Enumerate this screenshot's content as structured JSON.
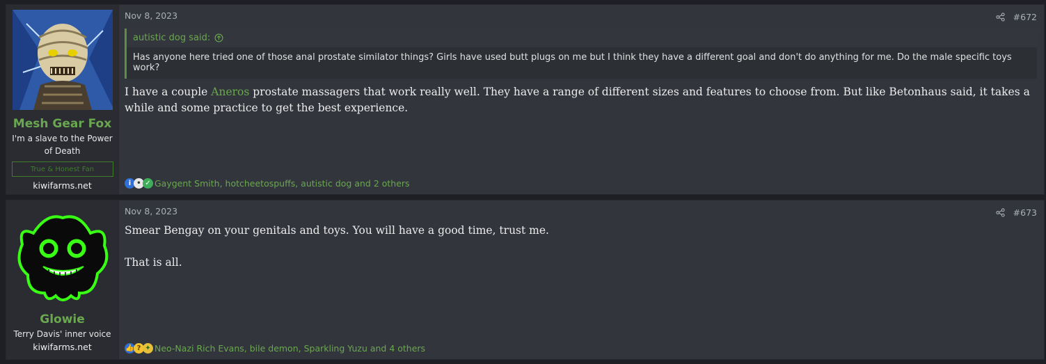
{
  "posts": [
    {
      "user": {
        "name": "Mesh Gear Fox",
        "title": "I'm a slave to the Power of Death",
        "banner": "True & Honest Fan",
        "site": "kiwifarms.net"
      },
      "date": "Nov 8, 2023",
      "number": "#672",
      "quote": {
        "author": "autistic dog said:",
        "text": "Has anyone here tried one of those anal prostate similator things? Girls have used butt plugs on me but I think they have a different goal and don't do anything for me. Do the male specific toys work?"
      },
      "body": {
        "pre": "I have a couple ",
        "link": "Aneros",
        "post": " prostate massagers that work really well. They have a range of different sizes and features to choose from. But like Betonhaus said, it takes a while and some practice to get the best experience."
      },
      "reactions": {
        "icons": [
          "informative-icon",
          "dog-icon",
          "check-icon"
        ],
        "text": "Gaygent Smith, hotcheetospuffs, autistic dog and 2 others"
      }
    },
    {
      "user": {
        "name": "Glowie",
        "title": "Terry Davis' inner voice",
        "site": "kiwifarms.net"
      },
      "date": "Nov 8, 2023",
      "number": "#673",
      "body": {
        "p1": "Smear Bengay on your genitals and toys. You will have a good time, trust me.",
        "p2": "That is all."
      },
      "reactions": {
        "icons": [
          "like-icon",
          "thinking-icon",
          "pineapple-icon"
        ],
        "text": "Neo-Nazi Rich Evans, bile demon, Sparkling Yuzu and 4 others"
      }
    }
  ],
  "colors": {
    "accent": "#6aa84f",
    "post_bg": "#32353c",
    "user_bg": "#2a2c32"
  }
}
